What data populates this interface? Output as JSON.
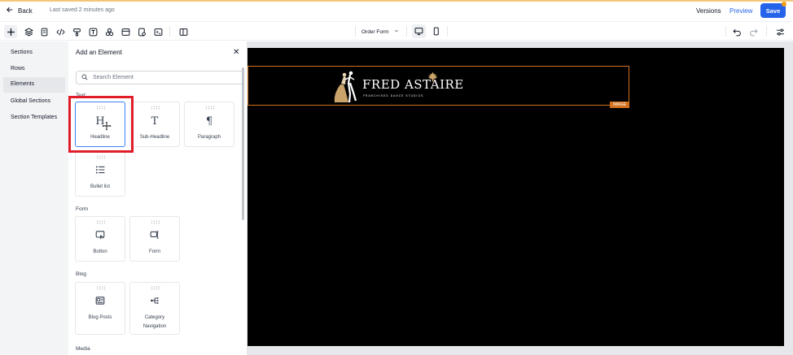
{
  "topbar": {
    "back_label": "Back",
    "saved_status": "Last saved 2 minutes ago",
    "versions_label": "Versions",
    "preview_label": "Preview",
    "save_label": "Save"
  },
  "toolbar": {
    "tools": [
      "add-icon",
      "layers-icon",
      "page-icon",
      "code-icon",
      "paint-icon",
      "text-icon",
      "components-icon",
      "layout-icon",
      "page-settings-icon",
      "terminal-icon",
      "panel-icon"
    ],
    "form_select": "Order Form",
    "devices": [
      "desktop-icon",
      "mobile-icon"
    ]
  },
  "leftnav": {
    "items": [
      {
        "label": "Sections"
      },
      {
        "label": "Rows"
      },
      {
        "label": "Elements"
      },
      {
        "label": "Global Sections"
      },
      {
        "label": "Section Templates"
      }
    ],
    "active": "Elements"
  },
  "panel": {
    "title": "Add an Element",
    "search_placeholder": "Search Element",
    "groups": [
      {
        "label": "Text",
        "items": [
          {
            "label": "Headline",
            "icon": "H"
          },
          {
            "label": "Sub-Headline",
            "icon": "T"
          },
          {
            "label": "Paragraph",
            "icon": "¶"
          },
          {
            "label": "Bullet list",
            "icon": "list"
          }
        ]
      },
      {
        "label": "Form",
        "items": [
          {
            "label": "Button",
            "icon": "button"
          },
          {
            "label": "Form",
            "icon": "form"
          }
        ]
      },
      {
        "label": "Blog",
        "items": [
          {
            "label": "Blog Posts",
            "icon": "blog"
          },
          {
            "label": "Category Navigation",
            "icon": "category"
          }
        ]
      },
      {
        "label": "Media",
        "items": []
      }
    ]
  },
  "canvas": {
    "image_tag": "IMAGE",
    "logo_name": "FRED ASTAIRE",
    "logo_subtitle": "FRANCHISED DANCE STUDIOS."
  },
  "colors": {
    "accent": "#2563eb",
    "highlight": "#e11d2a",
    "image_frame": "#d4711f",
    "canvas_bg": "#000000"
  }
}
